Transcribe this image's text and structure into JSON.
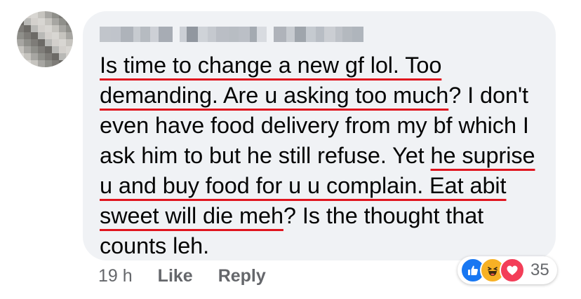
{
  "comment": {
    "author_name": "",
    "avatar_colors": [
      "#b9b9b6",
      "#8f8f8a",
      "#d8d6d2",
      "#6c6a66",
      "#a7a6a2",
      "#d3d0cc",
      "#7e7c78",
      "#c6c4bf"
    ],
    "author_blur_colors": [
      "#9aa0a8",
      "#b7bcc3",
      "#8b919a",
      "#c4c8cd",
      "#a3a8af",
      "#b0b5bc"
    ],
    "segments": [
      {
        "text": "Is time to change a new gf lol. Too demanding. Are u asking too much",
        "highlight": true
      },
      {
        "text": "? I don't even have food delivery from my bf which I ask him to but he still refuse. Yet ",
        "highlight": false
      },
      {
        "text": "he suprise u and buy food for u u complain. Eat abit sweet will die meh",
        "highlight": true
      },
      {
        "text": "? Is the thought that counts leh.",
        "highlight": false
      }
    ],
    "highlight_color": "#e0141e"
  },
  "actions": {
    "timestamp": "19 h",
    "like_label": "Like",
    "reply_label": "Reply"
  },
  "reactions": {
    "icons": [
      "like-icon",
      "haha-icon",
      "love-icon"
    ],
    "count": "35"
  }
}
